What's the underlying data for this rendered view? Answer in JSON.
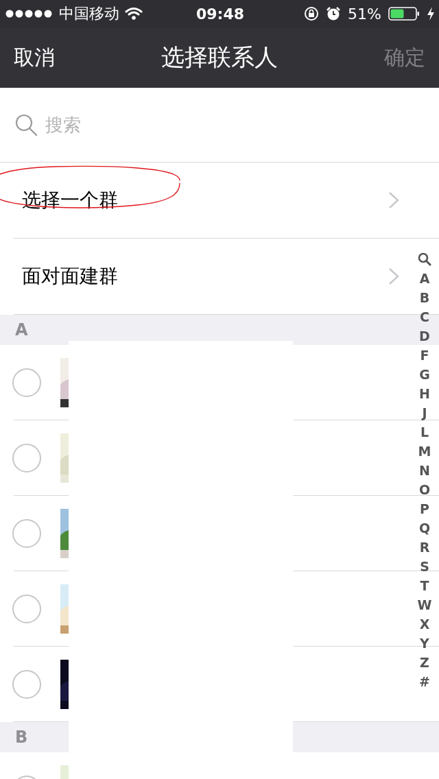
{
  "status_bar": {
    "carrier": "中国移动",
    "time": "09:48",
    "battery": "51%"
  },
  "nav": {
    "cancel": "取消",
    "title": "选择联系人",
    "confirm": "确定",
    "confirm_disabled": true
  },
  "search": {
    "placeholder": "搜索"
  },
  "menu": [
    {
      "label": "选择一个群",
      "annotated": true
    },
    {
      "label": "面对面建群",
      "annotated": false
    }
  ],
  "sections": [
    {
      "letter": "A",
      "contacts": [
        {
          "selected": false
        },
        {
          "selected": false
        },
        {
          "selected": false
        },
        {
          "selected": false
        },
        {
          "selected": false
        }
      ]
    },
    {
      "letter": "B",
      "contacts": [
        {
          "selected": false
        }
      ]
    }
  ],
  "index": [
    "A",
    "B",
    "C",
    "D",
    "F",
    "G",
    "H",
    "J",
    "L",
    "M",
    "N",
    "O",
    "P",
    "Q",
    "R",
    "S",
    "T",
    "W",
    "X",
    "Y",
    "Z",
    "#"
  ]
}
